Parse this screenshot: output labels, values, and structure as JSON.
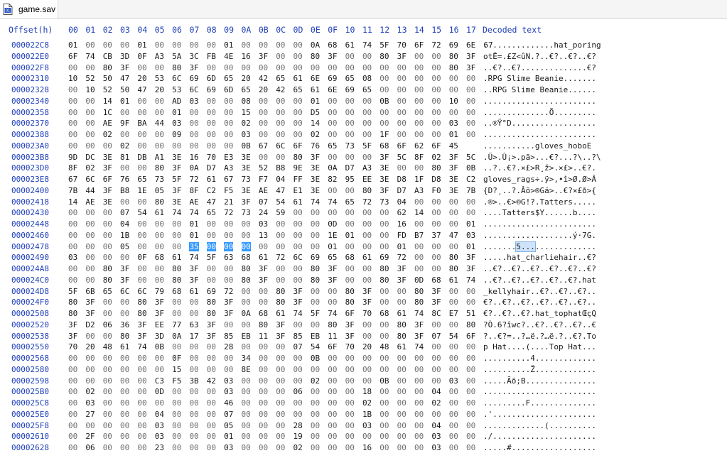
{
  "window": {
    "tab_title": "game.sav",
    "file_icon": "binary-file-icon"
  },
  "header": {
    "offset_label": "Offset(h)",
    "columns": [
      "00",
      "01",
      "02",
      "03",
      "04",
      "05",
      "06",
      "07",
      "08",
      "09",
      "0A",
      "0B",
      "0C",
      "0D",
      "0E",
      "0F",
      "10",
      "11",
      "12",
      "13",
      "14",
      "15",
      "16",
      "17"
    ],
    "decoded_label": "Decoded text"
  },
  "colors": {
    "offset": "#1f3fb8",
    "selection": "#3399ff",
    "selection_text": "#ffffff",
    "decoded_highlight": "#cfe4fb"
  },
  "selection": {
    "offset": "00002478",
    "byte_start": 7,
    "byte_end": 10,
    "decoded_char": "5"
  },
  "rows": [
    {
      "offset": "000022C8",
      "bytes": "01 00 00 00 01 00 00 00 00 01 00 00 00 00 0A 68 61 74 5F 70 6F 72 69 6E 67",
      "decoded": "...............hat_poring"
    },
    {
      "offset": "000022E0",
      "bytes": "6F 74 CB 3D 0F A3 5A 3C FB 4E 16 3F 00 00 80 3F 00 00 80 3F 00 00 80 3F",
      "decoded": "otË=.£Z<ûN.?..€?..€?..€?"
    },
    {
      "offset": "000022F8",
      "bytes": "00 00 80 3F 00 00 80 3F 00 00 00 00 00 00 00 00 00 00 00 00 00 00 80 3F",
      "decoded": "..€?..€?..............€?"
    },
    {
      "offset": "00002310",
      "bytes": "10 52 50 47 20 53 6C 69 6D 65 20 42 65 61 6E 69 65 08 00 00 00 00 00 00",
      "decoded": ".RPG Slime Beanie......."
    },
    {
      "offset": "00002328",
      "bytes": "00 10 52 50 47 20 53 6C 69 6D 65 20 42 65 61 6E 69 65 00 00 00 00 00 00",
      "decoded": "..RPG Slime Beanie......"
    },
    {
      "offset": "00002340",
      "bytes": "00 00 14 01 00 00 AD 03 00 00 08 00 00 00 01 00 00 00 0B 00 00 00 10 00",
      "decoded": "........................"
    },
    {
      "offset": "00002358",
      "bytes": "00 00 1C 00 00 00 01 00 00 00 15 00 00 00 D5 00 00 00 00 00 00 00 00 00",
      "decoded": "..............Õ........."
    },
    {
      "offset": "00002370",
      "bytes": "00 00 AE 9F BA 44 03 00 00 00 02 00 00 00 14 00 00 00 00 00 00 00 03 00",
      "decoded": "..®Ÿ°D.................."
    },
    {
      "offset": "00002388",
      "bytes": "00 00 02 00 00 00 09 00 00 00 03 00 00 00 02 00 00 00 1F 00 00 00 01 00",
      "decoded": "........................"
    },
    {
      "offset": "000023A0",
      "bytes": "00 00 00 02 00 00 00 00 00 00 0B 67 6C 6F 76 65 73 5F 68 6F 62 6F 45",
      "decoded": "...........gloves_hoboE"
    },
    {
      "offset": "000023B8",
      "bytes": "9D DC 3E 81 DB A1 3E 16 70 E3 3E 00 00 80 3F 00 00 00 3F 5C 8F 02 3F 5C",
      "decoded": ".Ü>.Û¡>.pã>...€?...?\\..?\\"
    },
    {
      "offset": "000023D0",
      "bytes": "8F 02 3F 00 00 80 3F 0A D7 A3 3E 52 B8 9E 3E 0A D7 A3 3E 00 00 80 3F 0B",
      "decoded": "..?..€?.×£>R¸ž>.×£>..€?."
    },
    {
      "offset": "000023E8",
      "bytes": "67 6C 6F 76 65 73 5F 72 61 67 73 F7 04 FF 3E 82 95 EE 3E D8 1F D8 3E C2",
      "decoded": "gloves_rags÷.ÿ>‚•î>Ø.Ø>Â"
    },
    {
      "offset": "00002400",
      "bytes": "7B 44 3F B8 1E 05 3F 8F C2 F5 3E AE 47 E1 3E 00 00 80 3F D7 A3 F0 3E 7B",
      "decoded": "{D?¸..?.Âõ>®Gá>..€?×£ð>{"
    },
    {
      "offset": "00002418",
      "bytes": "14 AE 3E 00 00 80 3E AE 47 21 3F 07 54 61 74 74 65 72 73 04 00 00 00 00",
      "decoded": ".®>..€>®G!?.Tatters....."
    },
    {
      "offset": "00002430",
      "bytes": "00 00 00 07 54 61 74 74 65 72 73 24 59 00 00 00 00 00 00 62 14 00 00 00",
      "decoded": "....Tatters$Y......b...."
    },
    {
      "offset": "00002448",
      "bytes": "00 00 00 04 00 00 00 01 00 00 00 03 00 00 00 0D 00 00 00 16 00 00 00 01",
      "decoded": "........................"
    },
    {
      "offset": "00002460",
      "bytes": "00 00 00 1B 00 00 00 01 00 00 00 13 00 00 00 1E 01 00 00 FD B7 37 47 03",
      "decoded": "...................ý·7G."
    },
    {
      "offset": "00002478",
      "bytes": "00 00 00 05 00 00 00 35 00 00 00 00 00 00 00 01 00 00 00 01 00 00 00 01",
      "decoded": ".......5................"
    },
    {
      "offset": "00002490",
      "bytes": "03 00 00 00 0F 68 61 74 5F 63 68 61 72 6C 69 65 68 61 69 72 00 00 80 3F",
      "decoded": ".....hat_charliehair..€?"
    },
    {
      "offset": "000024A8",
      "bytes": "00 00 80 3F 00 00 80 3F 00 00 80 3F 00 00 80 3F 00 00 80 3F 00 00 80 3F",
      "decoded": "..€?..€?..€?..€?..€?..€?"
    },
    {
      "offset": "000024C0",
      "bytes": "00 00 80 3F 00 00 80 3F 00 00 80 3F 00 00 80 3F 00 00 80 3F 0D 68 61 74",
      "decoded": "..€?..€?..€?..€?..€?.hat"
    },
    {
      "offset": "000024D8",
      "bytes": "5F 6B 65 6C 6C 79 68 61 69 72 00 00 80 3F 00 00 80 3F 00 00 80 3F 00 00",
      "decoded": "_kellyhair..€?..€?..€?.."
    },
    {
      "offset": "000024F0",
      "bytes": "80 3F 00 00 80 3F 00 00 80 3F 00 00 80 3F 00 00 80 3F 00 00 80 3F 00 00",
      "decoded": "€?..€?..€?..€?..€?..€?.."
    },
    {
      "offset": "00002508",
      "bytes": "80 3F 00 00 80 3F 00 00 80 3F 0A 68 61 74 5F 74 6F 70 68 61 74 8C E7 51",
      "decoded": "€?..€?..€?.hat_tophatŒçQ"
    },
    {
      "offset": "00002520",
      "bytes": "3F D2 06 36 3F EE 77 63 3F 00 00 80 3F 00 00 80 3F 00 00 80 3F 00 00 80",
      "decoded": "?Ò.6?îwc?..€?..€?..€?..€"
    },
    {
      "offset": "00002538",
      "bytes": "3F 00 00 80 3F 3D 0A 17 3F 85 EB 11 3F 85 EB 11 3F 00 00 80 3F 07 54 6F",
      "decoded": "?..€?=..?…ë.?…ë.?..€?.To"
    },
    {
      "offset": "00002550",
      "bytes": "70 20 48 61 74 0B 00 00 00 28 00 00 00 07 54 6F 70 20 48 61 74 00 00 00",
      "decoded": "p Hat....(....Top Hat..."
    },
    {
      "offset": "00002568",
      "bytes": "00 00 00 00 00 00 0F 00 00 00 34 00 00 00 0B 00 00 00 00 00 00 00 00 00",
      "decoded": "..........4............."
    },
    {
      "offset": "00002580",
      "bytes": "00 00 00 00 00 00 15 00 00 00 8E 00 00 00 00 00 00 00 00 00 00 00 00 00",
      "decoded": "..........Ž............."
    },
    {
      "offset": "00002598",
      "bytes": "00 00 00 00 00 C3 F5 3B 42 03 00 00 00 00 02 00 00 00 0B 00 00 00 03 00",
      "decoded": ".....Ãõ;B..............."
    },
    {
      "offset": "000025B0",
      "bytes": "00 02 00 00 00 0D 00 00 00 03 00 00 00 06 00 00 00 18 00 00 00 04 00 00",
      "decoded": "........................"
    },
    {
      "offset": "000025C8",
      "bytes": "00 03 00 00 00 00 00 00 00 46 00 00 00 00 00 00 00 02 00 00 00 02 00 00",
      "decoded": ".........F.............."
    },
    {
      "offset": "000025E0",
      "bytes": "00 27 00 00 00 04 00 00 00 07 00 00 00 00 00 00 00 1B 00 00 00 00 00 00",
      "decoded": ".'......................"
    },
    {
      "offset": "000025F8",
      "bytes": "00 00 00 00 00 03 00 00 00 05 00 00 00 28 00 00 00 03 00 00 00 04 00 00",
      "decoded": ".............(.........."
    },
    {
      "offset": "00002610",
      "bytes": "00 2F 00 00 00 03 00 00 00 01 00 00 00 19 00 00 00 00 00 00 00 03 00 00",
      "decoded": "./......................"
    },
    {
      "offset": "00002628",
      "bytes": "00 06 00 00 00 23 00 00 00 03 00 00 00 02 00 00 00 16 00 00 00 03 00 00",
      "decoded": ".....#.................."
    }
  ]
}
